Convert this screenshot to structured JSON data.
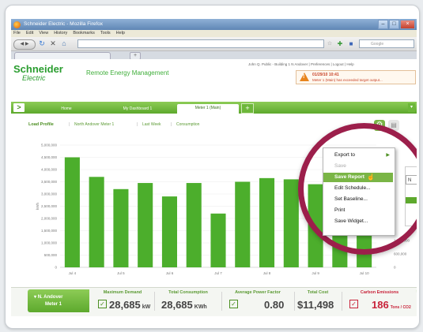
{
  "browser": {
    "title": "Schneider Electric - Mozilla Firefox",
    "menu": [
      "File",
      "Edit",
      "View",
      "History",
      "Bookmarks",
      "Tools",
      "Help"
    ],
    "url": "",
    "search_placeholder": "Google"
  },
  "app": {
    "logo_top": "Schneider",
    "logo_bottom": "Electric",
    "title": "Remote Energy Management",
    "user_links": "John Q. Public - Building 1 N Andover  |  Preferences  |  Logout  |  Help",
    "alert_date": "01/29/10 10:41",
    "alert_text": "Meter 1 (Main) has exceeded target output...",
    "accent": "#5da92d"
  },
  "nav": {
    "tabs": [
      "Home",
      "My Dashboard 1",
      "Meter 1 (Main)"
    ],
    "active": "Meter 1 (Main)"
  },
  "filters": {
    "title": "Load Profile",
    "items": [
      "North Andover Meter 1",
      "Last Week",
      "Consumption"
    ]
  },
  "context_menu": {
    "items": [
      "Export to",
      "Save",
      "Save Report",
      "Edit Schedule...",
      "Set Baseline...",
      "Print",
      "Save Widget..."
    ],
    "disabled": "Save",
    "highlighted": "Save Report"
  },
  "right_panel": {
    "label": "N"
  },
  "chart_data": {
    "type": "bar",
    "categories": [
      "Jul 4",
      "",
      "Jul 5",
      "",
      "Jul 6",
      "",
      "Jul 7",
      "",
      "Jul 8",
      "",
      "Jul 9",
      "",
      "Jul 10"
    ],
    "values": [
      4500000,
      3700000,
      3200000,
      3450000,
      2900000,
      3450000,
      2200000,
      3500000,
      3650000,
      3600000,
      3400000,
      3300000,
      3350000
    ],
    "ylabel": "kWh",
    "yticks_left": [
      "5,000,000",
      "4,500,000",
      "4,000,000",
      "3,500,000",
      "3,000,000",
      "2,500,000",
      "2,000,000",
      "1,500,000",
      "1,000,000",
      "500,000",
      "0"
    ],
    "yticks_right": [
      "1,200,000",
      "600,000",
      "0"
    ],
    "ylim": [
      0,
      5000000
    ],
    "color": "#4cae2c"
  },
  "summary": {
    "meter_line1": "N. Andover",
    "meter_line2": "Meter 1",
    "kpis": [
      {
        "label": "Maximum Demand",
        "value": "28,685",
        "unit": "kW"
      },
      {
        "label": "Total Consumption",
        "value": "28,685",
        "unit": "KWh"
      },
      {
        "label": "Average Power Factor",
        "value": "0.80",
        "unit": ""
      },
      {
        "label": "Total Cost",
        "value": "$11,498",
        "unit": ""
      },
      {
        "label": "Carbon Emissions",
        "value": "186",
        "unit": "Tons / CO2"
      }
    ]
  }
}
